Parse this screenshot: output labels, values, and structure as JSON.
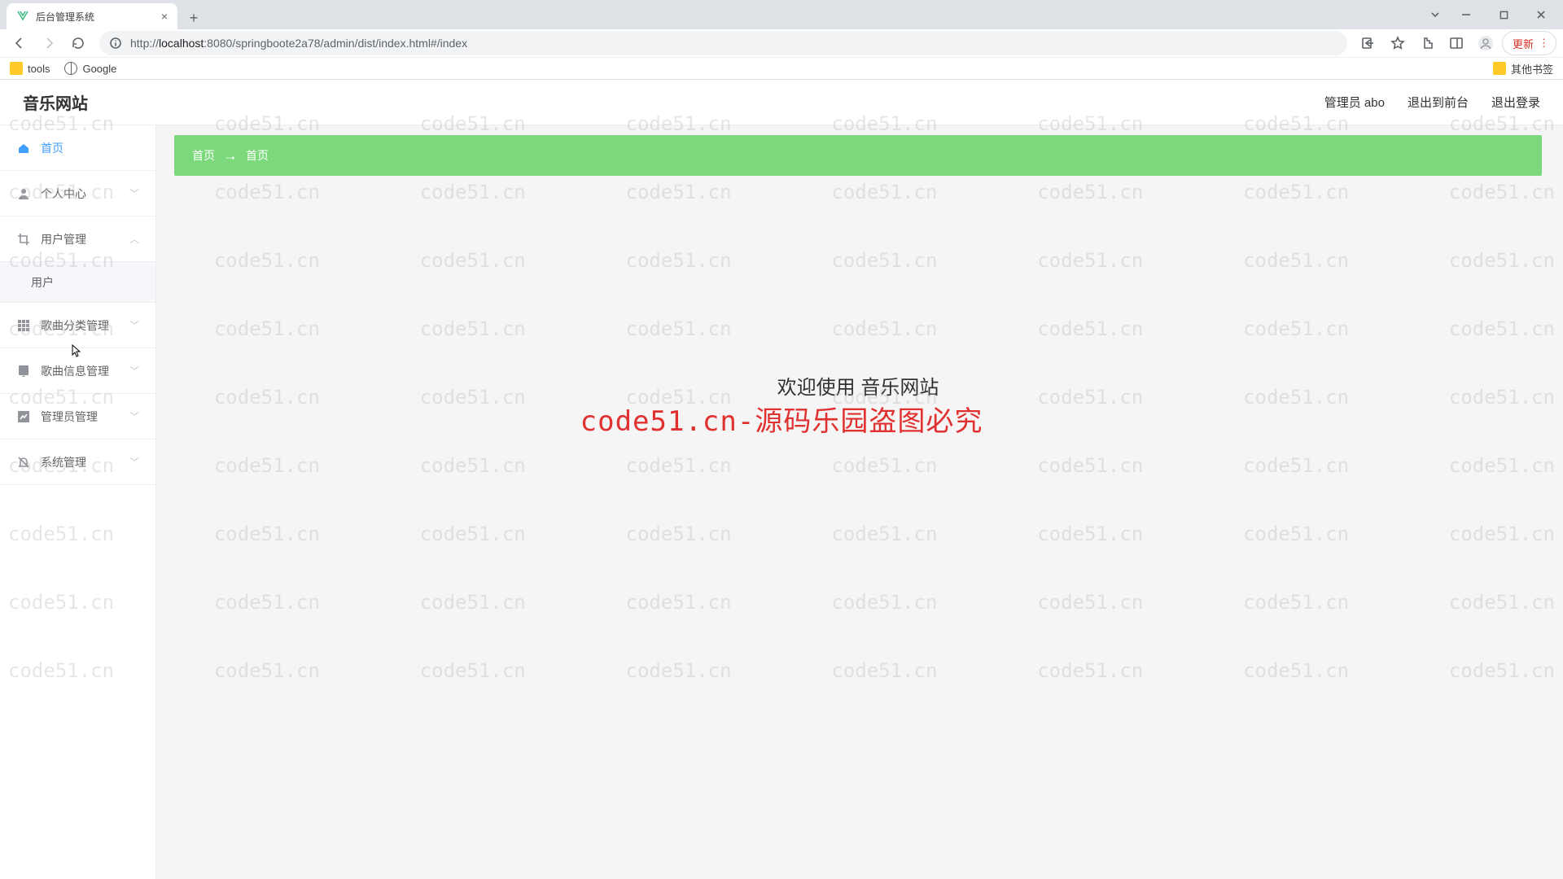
{
  "browser": {
    "tab_title": "后台管理系统",
    "url_host": "localhost",
    "url_port": ":8080",
    "url_path": "/springboote2a78/admin/dist/index.html#/index",
    "url_prefix": "http://",
    "bookmark_tools": "tools",
    "bookmark_google": "Google",
    "bookmark_other": "其他书签",
    "update_label": "更新"
  },
  "app": {
    "title": "音乐网站",
    "header_user": "管理员 abo",
    "header_exit_front": "退出到前台",
    "header_logout": "退出登录",
    "breadcrumb_root": "首页",
    "breadcrumb_current": "首页",
    "welcome_text": "欢迎使用 音乐网站"
  },
  "sidebar": {
    "home": "首页",
    "profile": "个人中心",
    "user_mgmt": "用户管理",
    "user_sub": "用户",
    "song_category": "歌曲分类管理",
    "song_info": "歌曲信息管理",
    "admin_mgmt": "管理员管理",
    "system_mgmt": "系统管理"
  },
  "watermark": {
    "text": "code51.cn",
    "banner": "code51.cn-源码乐园盗图必究"
  }
}
